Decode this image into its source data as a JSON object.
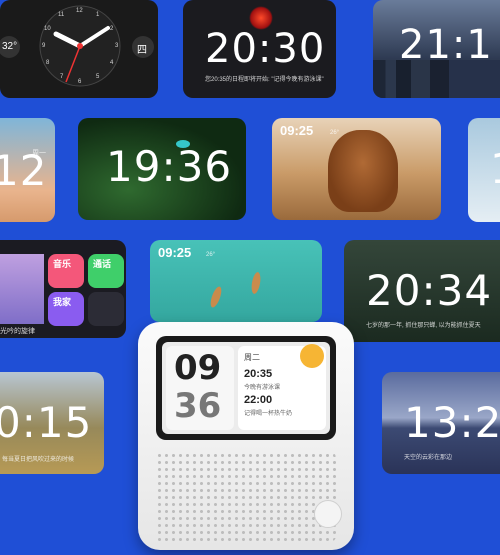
{
  "colors": {
    "background": "#1f4fd6",
    "accent_orange": "#f6b534",
    "device_white": "#f2f2f2"
  },
  "cards": {
    "analog": {
      "day_left": "32°",
      "day_right": "四",
      "numerals": [
        "12",
        "1",
        "2",
        "3",
        "4",
        "5",
        "6",
        "7",
        "8",
        "9",
        "10",
        "11"
      ]
    },
    "dark2030": {
      "time": "20:30",
      "note": "您20:35的日程即将开始: \"记得今晚有游泳课\""
    },
    "city": {
      "time": "21:1"
    },
    "desert": {
      "time": "12",
      "weekday": "周一"
    },
    "leaves": {
      "time": "19:36"
    },
    "dog": {
      "time": "09:25",
      "weather": "26°"
    },
    "right_edge": {
      "time": "1"
    },
    "apps": {
      "caption": "光吟的旋律",
      "apps": [
        "音乐",
        "通话",
        "我家"
      ]
    },
    "boats": {
      "time": "09:25",
      "weather": "26°"
    },
    "grass": {
      "time": "20:34",
      "note": "七岁的那一年, 抓住那只蝉, 以为能抓住夏天"
    },
    "field": {
      "time": "0:15",
      "note": "每当夏日把风吹过来的时候"
    },
    "lake": {
      "time": "13:2",
      "note": "天空的云彩在那边"
    }
  },
  "device": {
    "hour": "09",
    "minute": "36",
    "weekday": "周二",
    "events": [
      {
        "time": "20:35",
        "title": "今晚有游泳课"
      },
      {
        "time": "22:00",
        "title": "记得喝一杯热牛奶"
      }
    ]
  }
}
